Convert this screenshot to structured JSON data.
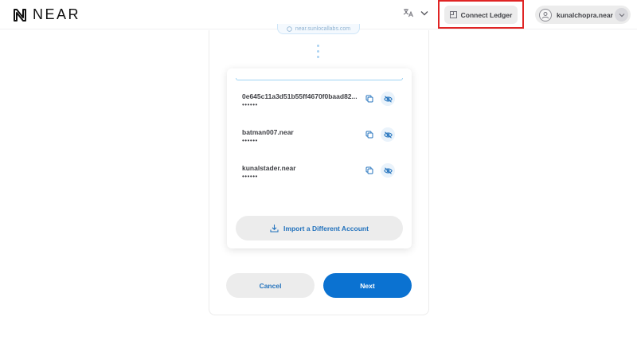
{
  "header": {
    "logo_text": "NEAR",
    "connect_ledger_label": "Connect Ledger",
    "account_name": "kunalchopra.near"
  },
  "recovery": {
    "pill_text": "near.sunlocallabs.com"
  },
  "accounts": [
    {
      "name": "0e645c11a3d51b55ff4670f0baad82...",
      "masked": "••••••"
    },
    {
      "name": "batman007.near",
      "masked": "••••••"
    },
    {
      "name": "kunalstader.near",
      "masked": "••••••"
    }
  ],
  "actions": {
    "import_label": "Import a Different Account",
    "cancel_label": "Cancel",
    "next_label": "Next"
  },
  "colors": {
    "accent": "#0b72d1",
    "link": "#2473bd",
    "highlight": "#e02424",
    "button_bg": "#ececec"
  },
  "icons": {
    "logo": "near-logo-icon",
    "language": "translate-icon",
    "ledger": "ledger-icon",
    "avatar": "user-avatar-icon",
    "copy": "copy-icon",
    "hide": "eye-off-icon",
    "import": "download-icon"
  }
}
